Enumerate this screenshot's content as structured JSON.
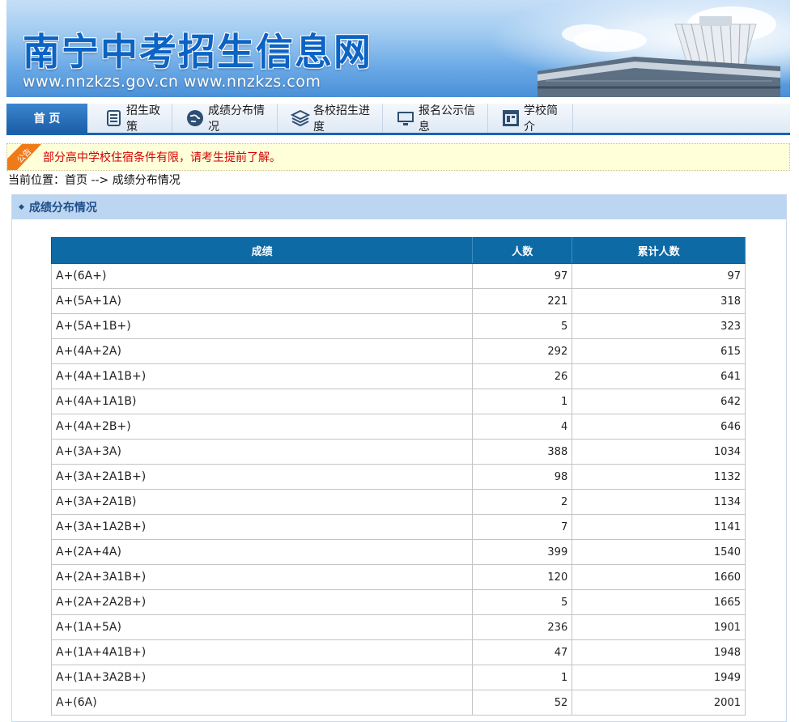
{
  "site": {
    "title": "南宁中考招生信息网",
    "domains": "www.nnzkzs.gov.cn  www.nnzkzs.com"
  },
  "nav": {
    "items": [
      {
        "label": "首 页",
        "icon": "home"
      },
      {
        "label": "招生政策",
        "icon": "policy-document-icon"
      },
      {
        "label": "成绩分布情况",
        "icon": "globe-icon"
      },
      {
        "label": "各校招生进度",
        "icon": "layers-icon"
      },
      {
        "label": "报名公示信息",
        "icon": "monitor-icon"
      },
      {
        "label": "学校简介",
        "icon": "window-icon"
      }
    ]
  },
  "notice": {
    "badge": "公告",
    "text": "部分高中学校住宿条件有限，请考生提前了解。"
  },
  "breadcrumb": "当前位置：首页 --> 成绩分布情况",
  "panel": {
    "title": "成绩分布情况"
  },
  "table": {
    "headers": [
      "成绩",
      "人数",
      "累计人数"
    ],
    "rows": [
      [
        "A+(6A+)",
        "97",
        "97"
      ],
      [
        "A+(5A+1A)",
        "221",
        "318"
      ],
      [
        "A+(5A+1B+)",
        "5",
        "323"
      ],
      [
        "A+(4A+2A)",
        "292",
        "615"
      ],
      [
        "A+(4A+1A1B+)",
        "26",
        "641"
      ],
      [
        "A+(4A+1A1B)",
        "1",
        "642"
      ],
      [
        "A+(4A+2B+)",
        "4",
        "646"
      ],
      [
        "A+(3A+3A)",
        "388",
        "1034"
      ],
      [
        "A+(3A+2A1B+)",
        "98",
        "1132"
      ],
      [
        "A+(3A+2A1B)",
        "2",
        "1134"
      ],
      [
        "A+(3A+1A2B+)",
        "7",
        "1141"
      ],
      [
        "A+(2A+4A)",
        "399",
        "1540"
      ],
      [
        "A+(2A+3A1B+)",
        "120",
        "1660"
      ],
      [
        "A+(2A+2A2B+)",
        "5",
        "1665"
      ],
      [
        "A+(1A+5A)",
        "236",
        "1901"
      ],
      [
        "A+(1A+4A1B+)",
        "47",
        "1948"
      ],
      [
        "A+(1A+3A2B+)",
        "1",
        "1949"
      ],
      [
        "A+(6A)",
        "52",
        "2001"
      ]
    ]
  }
}
